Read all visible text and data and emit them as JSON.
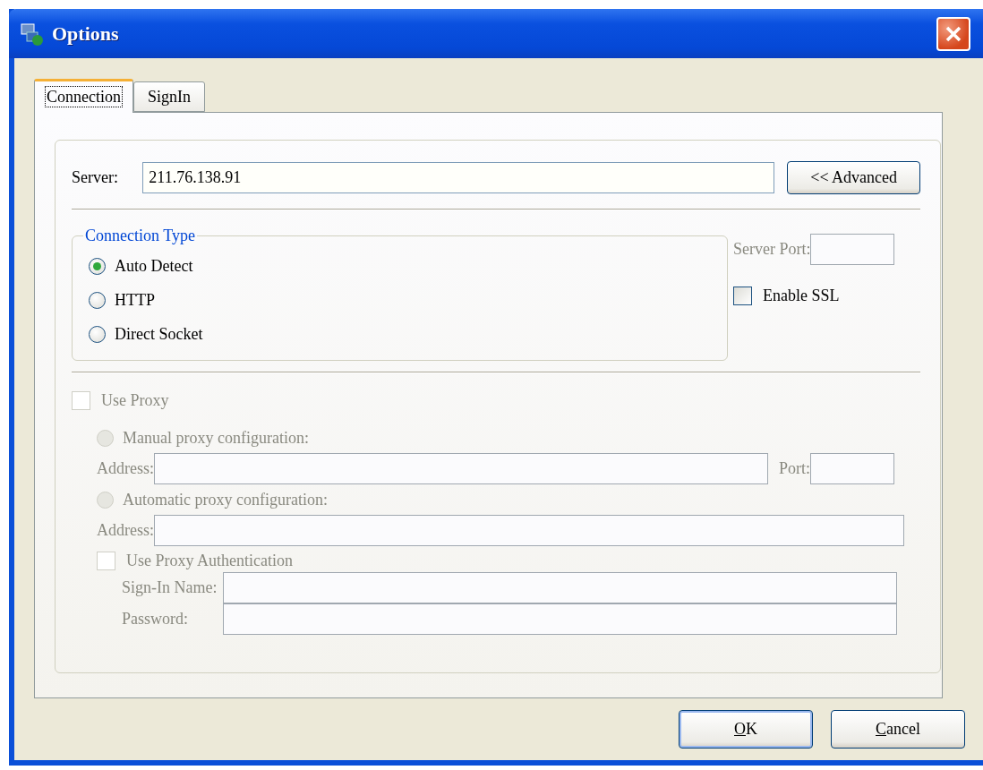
{
  "window": {
    "title": "Options"
  },
  "tabs": [
    {
      "label": "Connection",
      "selected": true
    },
    {
      "label": "SignIn",
      "selected": false
    }
  ],
  "server": {
    "label": "Server:",
    "value": "211.76.138.91"
  },
  "advanced_button": {
    "label": "<< Advanced"
  },
  "connection_type": {
    "title": "Connection Type",
    "options": [
      {
        "label": "Auto Detect",
        "selected": true
      },
      {
        "label": "HTTP",
        "selected": false
      },
      {
        "label": "Direct Socket",
        "selected": false
      }
    ]
  },
  "server_port": {
    "label": "Server Port:",
    "disabled": true
  },
  "enable_ssl": {
    "label": "Enable SSL",
    "checked": false
  },
  "proxy": {
    "disabled": true,
    "use_proxy": {
      "label": "Use Proxy",
      "checked": false
    },
    "manual": {
      "label": "Manual proxy configuration:",
      "selected": false,
      "address_label": "Address:",
      "port_label": "Port:"
    },
    "automatic": {
      "label": "Automatic proxy configuration:",
      "selected": false,
      "address_label": "Address:"
    },
    "authentication": {
      "label": "Use Proxy Authentication",
      "checked": false,
      "sign_in_name_label": "Sign-In Name:",
      "password_label": "Password:"
    }
  },
  "buttons": [
    {
      "access_key": "O",
      "label_rest": "K",
      "default": true
    },
    {
      "access_key": "C",
      "label_rest": "ancel",
      "default": false
    }
  ]
}
